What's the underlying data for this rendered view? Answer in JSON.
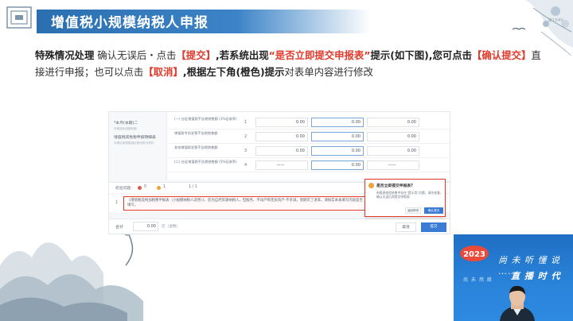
{
  "header": {
    "title": "增值税小规模纳税人申报",
    "corner_text": "第13/45"
  },
  "instruction": {
    "seg1": "特殊情况处理",
    "seg2": " 确认无误后・点击",
    "seg3": "【提交】",
    "seg4": ",若系统出现",
    "seg5": "“是否立即提交申报表”",
    "seg6": "提示(如下图),您可点击",
    "seg7": "【确认提交】",
    "seg8": "直接进行申报；也可以点击",
    "seg9": "【取消】",
    "seg10": ",根据左下角(橙色)提示",
    "seg11": "对表单内容进行修改"
  },
  "sidebar": {
    "items": [
      {
        "label": "*本月(本期)二",
        "sub": "本期减免税额明细"
      },
      {
        "label": "增值税减免税申报明细表",
        "sub": "本期应纳税额减征额及附列资料"
      }
    ]
  },
  "rows": [
    {
      "label": "(一) 应征增值税不含税销售额 (3%征收率)",
      "num": "1",
      "v1": "0.00",
      "v2": "0.00",
      "v3": "0.00"
    },
    {
      "label": "增值税专用发票不含税销售额",
      "num": "2",
      "v1": "0.00",
      "v2": "0.00",
      "v3": "0.00"
    },
    {
      "label": "其他增值税发票不含税销售额",
      "num": "3",
      "v1": "0.00",
      "v2": "0.00",
      "v3": "0.00"
    },
    {
      "label": "(二) 应征增值税不含税销售额 (5%征收率)",
      "num": "4",
      "v1": "——",
      "v2": "0.00",
      "v3": "——"
    }
  ],
  "status": {
    "label": "校验问题:",
    "red_count": "0",
    "orange_count": "1",
    "pager": "1 / 1"
  },
  "message": {
    "num": "1",
    "text": "《增值税及附加税费申报表（小规模纳税人适用）》，您为自然资源纳税人，但服务、不动产和无形资产-不享减，到期可了退库。请核实本表填写内容是否填写。"
  },
  "footer": {
    "total_label": "合计",
    "amount": "0.00",
    "unit": "元（含税）",
    "cancel": "取消",
    "submit": "提交"
  },
  "popup": {
    "title": "是否立即提交申报表?",
    "body": "申报表校验结果中存在“提示类”问题，请先核查，确认无误后再提交申报表",
    "cancel": "返回修改",
    "ok": "确认提交"
  },
  "video": {
    "slogan1": "尚 未 听 懂 说 ……",
    "slogan2": "直 播 时 代",
    "left_text": "尚 未 然 疏",
    "logo_text": "2023"
  },
  "colors": {
    "accent_red": "#e23a2b",
    "title_blue": "#2b6fb0",
    "submit_blue": "#3a7bd5",
    "warn_orange": "#f0a23b"
  }
}
